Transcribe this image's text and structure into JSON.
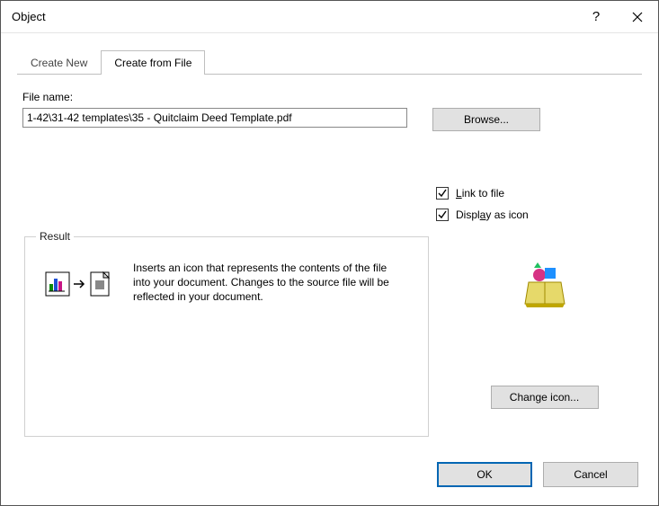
{
  "dialog": {
    "title": "Object"
  },
  "tabs": {
    "create_new": "Create New",
    "create_from_file": "Create from File"
  },
  "file": {
    "label": "File name:",
    "value": "1-42\\31-42 templates\\35 - Quitclaim Deed Template.pdf",
    "browse": "Browse..."
  },
  "options": {
    "link_to_file": "Link to file",
    "display_as_icon": "Display as icon",
    "link_checked": true,
    "icon_checked": true
  },
  "result": {
    "legend": "Result",
    "description": "Inserts an icon that represents the contents of the file into your document. Changes to the source file will be reflected in your document."
  },
  "buttons": {
    "change_icon": "Change icon...",
    "ok": "OK",
    "cancel": "Cancel"
  }
}
